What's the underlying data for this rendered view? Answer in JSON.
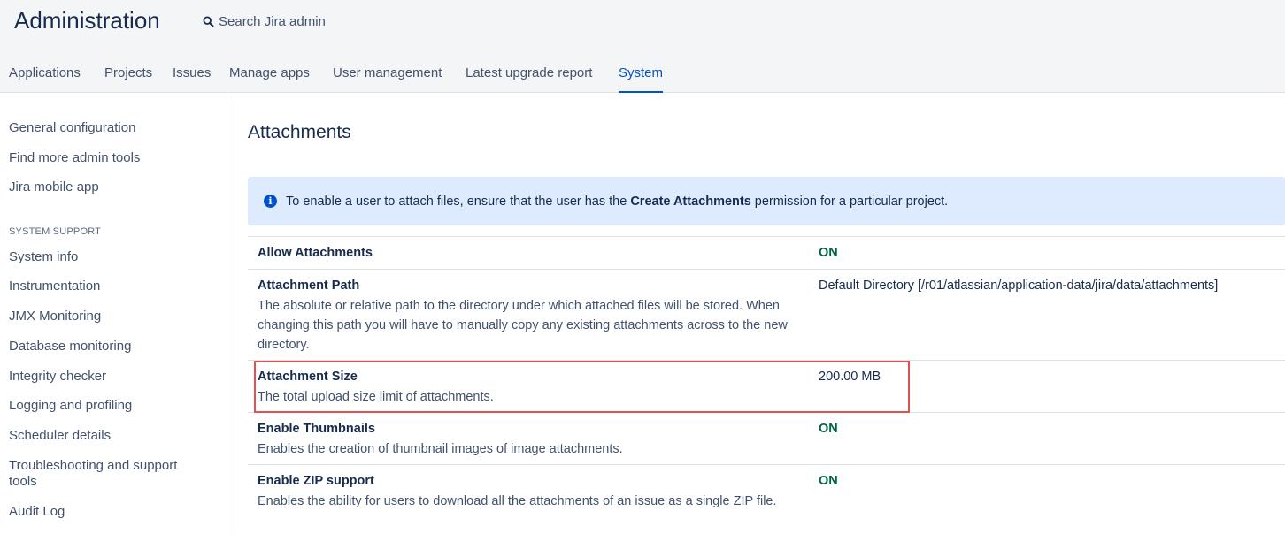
{
  "header": {
    "title": "Administration",
    "search_placeholder": "Search Jira admin",
    "search_icon": "search-icon"
  },
  "tabs": [
    {
      "label": "Applications",
      "active": false
    },
    {
      "label": "Projects",
      "active": false
    },
    {
      "label": "Issues",
      "active": false
    },
    {
      "label": "Manage apps",
      "active": false
    },
    {
      "label": "User management",
      "active": false
    },
    {
      "label": "Latest upgrade report",
      "active": false
    },
    {
      "label": "System",
      "active": true
    }
  ],
  "sidebar": {
    "items_top": [
      "General configuration",
      "Find more admin tools",
      "Jira mobile app"
    ],
    "section_heading": "SYSTEM SUPPORT",
    "items_support": [
      "System info",
      "Instrumentation",
      "JMX Monitoring",
      "Database monitoring",
      "Integrity checker",
      "Logging and profiling",
      "Scheduler details",
      "Troubleshooting and support tools",
      "Audit Log"
    ]
  },
  "main": {
    "title": "Attachments",
    "info": {
      "icon": "info-icon",
      "text_before": "To enable a user to attach files, ensure that the user has the ",
      "text_bold": "Create Attachments",
      "text_after": " permission for a particular project."
    },
    "settings": [
      {
        "name": "Allow Attachments",
        "description": "",
        "value": "ON"
      },
      {
        "name": "Attachment Path",
        "description": "The absolute or relative path to the directory under which attached files will be stored. When changing this path you will have to manually copy any existing attachments across to the new directory.",
        "value": "Default Directory [/r01/atlassian/application-data/jira/data/attachments]"
      },
      {
        "name": "Attachment Size",
        "description": "The total upload size limit of attachments.",
        "value": "200.00 MB"
      },
      {
        "name": "Enable Thumbnails",
        "description": "Enables the creation of thumbnail images of image attachments.",
        "value": "ON"
      },
      {
        "name": "Enable ZIP support",
        "description": "Enables the ability for users to download all the attachments of an issue as a single ZIP file.",
        "value": "ON"
      }
    ]
  },
  "colors": {
    "accent": "#0052cc",
    "on_status": "#006644",
    "highlight_border": "#e05252",
    "info_background": "#deebff"
  }
}
